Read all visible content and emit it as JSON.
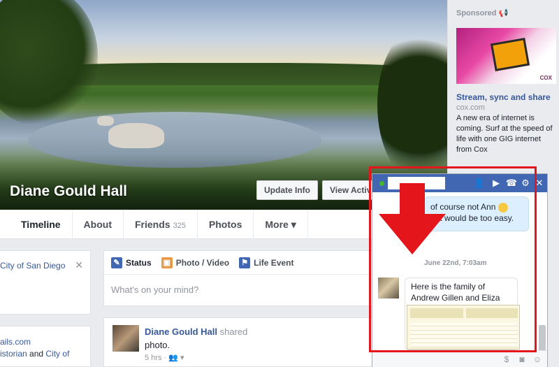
{
  "cover": {
    "name": "Diane Gould Hall",
    "update_info": "Update Info",
    "view_activity": "View Activi"
  },
  "nav": {
    "timeline": "Timeline",
    "about": "About",
    "friends": "Friends",
    "friends_count": "325",
    "photos": "Photos",
    "more": "More ▾"
  },
  "left": {
    "card1_text": "City of San Diego",
    "card1_close": "✕",
    "line1": "ails.com",
    "line2_a": "istorian",
    "line2_b": " and ",
    "line2_c": "City of"
  },
  "composer": {
    "status": "Status",
    "photo_video": "Photo / Video",
    "life_event": "Life Event",
    "placeholder": "What's on your mind?"
  },
  "post": {
    "author": "Diane Gould Hall",
    "action": " shared",
    "subtitle": "photo.",
    "time": "5 hrs · 👥 ▾"
  },
  "sidebar": {
    "sponsored": "Sponsored 📢",
    "ad_brand": "COX",
    "ad_headline": "Stream, sync and share",
    "ad_url": "cox.com",
    "ad_body": "A new era of internet is coming. Surf at the speed of life with one GIG internet from Cox"
  },
  "chat": {
    "msg_out_1": "of course not Ann",
    "msg_out_2": "hat would be too easy.",
    "date": "June 22nd, 7:03am",
    "msg_in": "Here is the family of Andrew Gillen and Eliza Tuggle",
    "icons": [
      "add-friend-icon",
      "video-call-icon",
      "phone-icon",
      "gear-icon",
      "close-icon"
    ]
  },
  "colors": {
    "fb_blue": "#4267b2",
    "link_blue": "#365899",
    "annotation_red": "#e5161b"
  }
}
